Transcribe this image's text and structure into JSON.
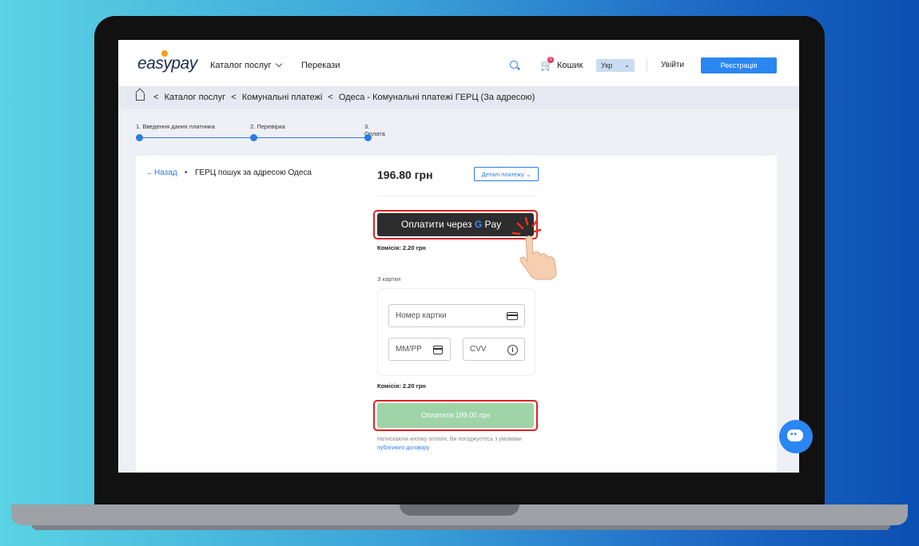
{
  "header": {
    "logo": "easypay",
    "nav_catalog": "Каталог послуг",
    "nav_transfers": "Перекази",
    "cart_label": "Кошик",
    "cart_count": "0",
    "language": "Укр",
    "login": "Увійти",
    "register": "Реєстрація"
  },
  "breadcrumb": {
    "items": [
      "Каталог послуг",
      "Комунальні платежі",
      "Одеса - Комунальні платежі ГЕРЦ (За адресою)"
    ]
  },
  "stepper": {
    "steps": [
      "1. Введення даних платника",
      "2. Перевірка",
      "3. Оплата"
    ]
  },
  "payment": {
    "back_label": "Назад",
    "service_name": "ГЕРЦ пошук за адресою Одеса",
    "amount": "196.80 грн",
    "details_label": "Деталі платежу",
    "gpay_text": "Оплатити через",
    "gpay_brand_g": "G",
    "gpay_brand_pay": "Pay",
    "gpay_fee": "Комісія: 2.20 грн",
    "from_card_label": "З картки",
    "card_number_placeholder": "Номер картки",
    "expiry_placeholder": "ММ/РР",
    "cvv_placeholder": "CVV",
    "card_fee": "Комісія: 2.20 грн",
    "pay_button": "Оплатити 199.00 грн",
    "terms_text": "Натискаючи кнопку оплати, Ви погоджуєтесь з умовами",
    "terms_link": "публічного договору"
  },
  "colors": {
    "accent": "#2a7de1",
    "pay_button": "#9fd4a8",
    "gpay_button": "#2d2d2d",
    "highlight": "#e02020"
  }
}
